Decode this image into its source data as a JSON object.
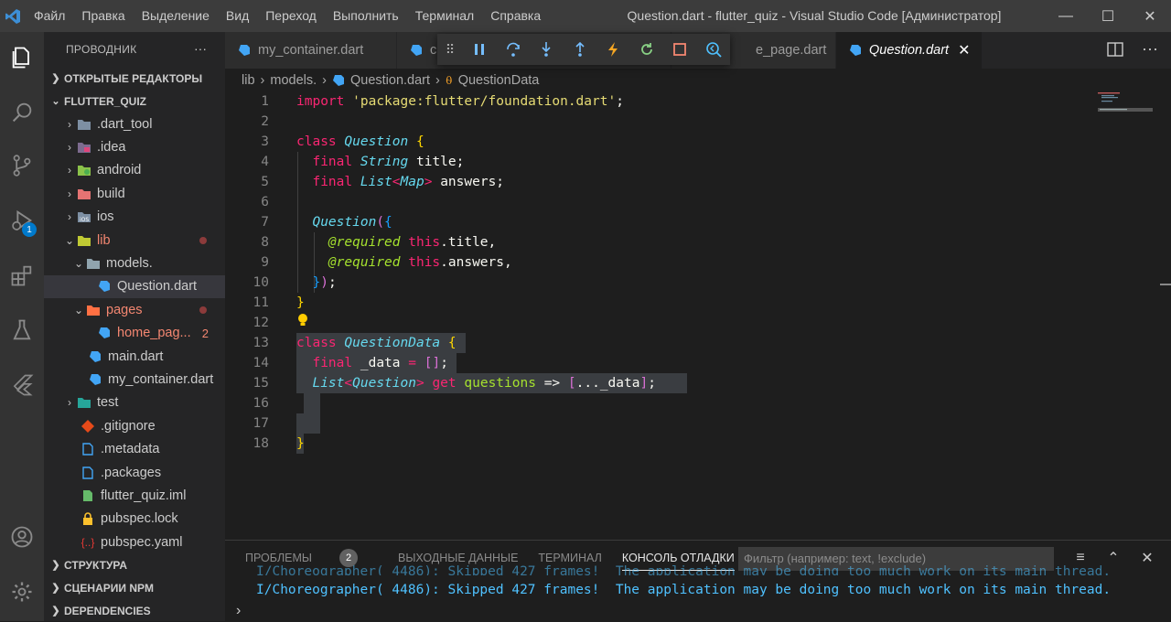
{
  "window": {
    "title": "Question.dart - flutter_quiz - Visual Studio Code [Администратор]",
    "menu": [
      "Файл",
      "Правка",
      "Выделение",
      "Вид",
      "Переход",
      "Выполнить",
      "Терминал",
      "Справка"
    ],
    "controls": [
      "minimize",
      "maximize",
      "close"
    ]
  },
  "activity_bar": {
    "items": [
      "explorer-icon",
      "search-icon",
      "source-control-icon",
      "run-debug-icon",
      "extensions-icon",
      "testing-icon",
      "flutter-icon"
    ],
    "debug_badge": "1",
    "bottom": [
      "account-icon",
      "settings-gear-icon"
    ]
  },
  "sidebar": {
    "title": "ПРОВОДНИК",
    "more": "···",
    "open_editors": "ОТКРЫТЫЕ РЕДАКТОРЫ",
    "project": "FLUTTER_QUIZ",
    "tree": [
      {
        "label": ".dart_tool",
        "kind": "folder"
      },
      {
        "label": ".idea",
        "kind": "folder"
      },
      {
        "label": "android",
        "kind": "folder"
      },
      {
        "label": "build",
        "kind": "folder"
      },
      {
        "label": "ios",
        "kind": "folder"
      },
      {
        "label": "lib",
        "kind": "folder-open"
      },
      {
        "label": "models.",
        "kind": "folder-open"
      },
      {
        "label": "Question.dart",
        "kind": "dart"
      },
      {
        "label": "pages",
        "kind": "folder-open"
      },
      {
        "label": "home_pag...",
        "kind": "dart",
        "count": "2"
      },
      {
        "label": "main.dart",
        "kind": "dart"
      },
      {
        "label": "my_container.dart",
        "kind": "dart"
      },
      {
        "label": "test",
        "kind": "folder"
      },
      {
        "label": ".gitignore",
        "kind": "git"
      },
      {
        "label": ".metadata",
        "kind": "file"
      },
      {
        "label": ".packages",
        "kind": "file"
      },
      {
        "label": "flutter_quiz.iml",
        "kind": "file"
      },
      {
        "label": "pubspec.lock",
        "kind": "lock"
      },
      {
        "label": "pubspec.yaml",
        "kind": "yaml"
      }
    ],
    "outline": "СТРУКТУРА",
    "npm": "СЦЕНАРИИ NPM",
    "deps": "DEPENDENCIES"
  },
  "tabs": [
    {
      "label": "my_container.dart"
    },
    {
      "label": "c"
    },
    {
      "label": "e_page.dart"
    },
    {
      "label": "Question.dart",
      "active": true
    }
  ],
  "debug_toolbar": [
    "drag-grip",
    "pause-icon",
    "step-over-icon",
    "step-into-icon",
    "step-out-icon",
    "hot-reload-icon",
    "restart-icon",
    "stop-icon",
    "devtools-icon"
  ],
  "breadcrumb": [
    "lib",
    "models.",
    "Question.dart",
    "QuestionData"
  ],
  "code": [
    "import 'package:flutter/foundation.dart';",
    "",
    "class Question {",
    "  final String title;",
    "  final List<Map> answers;",
    "",
    "  Question({",
    "    @required this.title,",
    "    @required this.answers,",
    "  });",
    "}",
    "",
    "class QuestionData {",
    "  final _data = [];",
    "  List<Question> get questions => [..._data];",
    "",
    "",
    "}"
  ],
  "line_numbers": [
    "1",
    "2",
    "3",
    "4",
    "5",
    "6",
    "7",
    "8",
    "9",
    "10",
    "11",
    "12",
    "13",
    "14",
    "15",
    "16",
    "17",
    "18"
  ],
  "panel": {
    "tabs": [
      "ПРОБЛЕМЫ",
      "ВЫХОДНЫЕ ДАННЫЕ",
      "ТЕРМИНАЛ",
      "КОНСОЛЬ ОТЛАДКИ"
    ],
    "problems_count": "2",
    "filter_placeholder": "Фильтр (например: text, !exclude)",
    "output_partial": "I/Choreographer( 4486): Skipped 427 frames!  The application may be doing too much work on its main thread.",
    "output_line": "I/Choreographer( 4486): Skipped 427 frames!  The application may be doing too much work on its main thread.",
    "prompt": "›"
  }
}
